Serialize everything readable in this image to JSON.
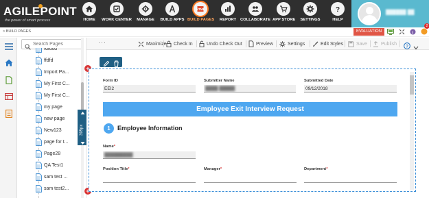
{
  "brand": {
    "name": "AGILEPOINT",
    "tagline": "the power of smart process"
  },
  "nav": {
    "items": [
      {
        "label": "HOME",
        "icon": "home-icon"
      },
      {
        "label": "WORK CENTER",
        "icon": "work-center-icon"
      },
      {
        "label": "MANAGE",
        "icon": "manage-icon"
      },
      {
        "label": "BUILD APPS",
        "icon": "build-apps-icon"
      },
      {
        "label": "BUILD PAGES",
        "icon": "build-pages-icon",
        "active": true
      },
      {
        "label": "REPORT",
        "icon": "report-icon"
      },
      {
        "label": "COLLABORATE",
        "icon": "collaborate-icon"
      },
      {
        "label": "APP STORE",
        "icon": "app-store-icon"
      },
      {
        "label": "SETTINGS",
        "icon": "settings-icon"
      },
      {
        "label": "HELP",
        "icon": "help-icon"
      }
    ],
    "active_color": "#ff7a22",
    "user_name": "██████ ██"
  },
  "breadcrumb": "> BUILD PAGES",
  "badge": {
    "evaluation": "EVALUATION",
    "color": "#e05545"
  },
  "notification_count": "2",
  "pages_panel": {
    "search_placeholder": "Search Pages",
    "items": [
      "fdfdsd",
      "ffdfd",
      "Import Pa...",
      "My First C...",
      "My First C...",
      "my page",
      "new page",
      "New123",
      "page for t...",
      "Page28",
      "QA Test1",
      "sam test ...",
      "sam test2..."
    ],
    "resize_label": "395px"
  },
  "toolbar": {
    "maximize": "Maximize",
    "check_in": "Check In",
    "undo_check_out": "Undo Check Out",
    "preview": "Preview",
    "settings": "Settings",
    "edit_styles": "Edit Styles",
    "save": "Save",
    "publish": "Publish"
  },
  "form": {
    "form_id_label": "Form ID",
    "form_id_value": "EEI2",
    "submitter_name_label": "Submitter Name",
    "submitter_name_value": "████ █████",
    "submitted_date_label": "Submitted Date",
    "submitted_date_value": "09/12/2018",
    "banner_title": "Employee Exit Interview Request",
    "section_number": "1",
    "section_title": "Employee Information",
    "name_label": "Name",
    "name_value": "█████████",
    "position_title_label": "Position Title",
    "manager_label": "Manager",
    "department_label": "Department",
    "accent_color": "#4ea7f0"
  }
}
